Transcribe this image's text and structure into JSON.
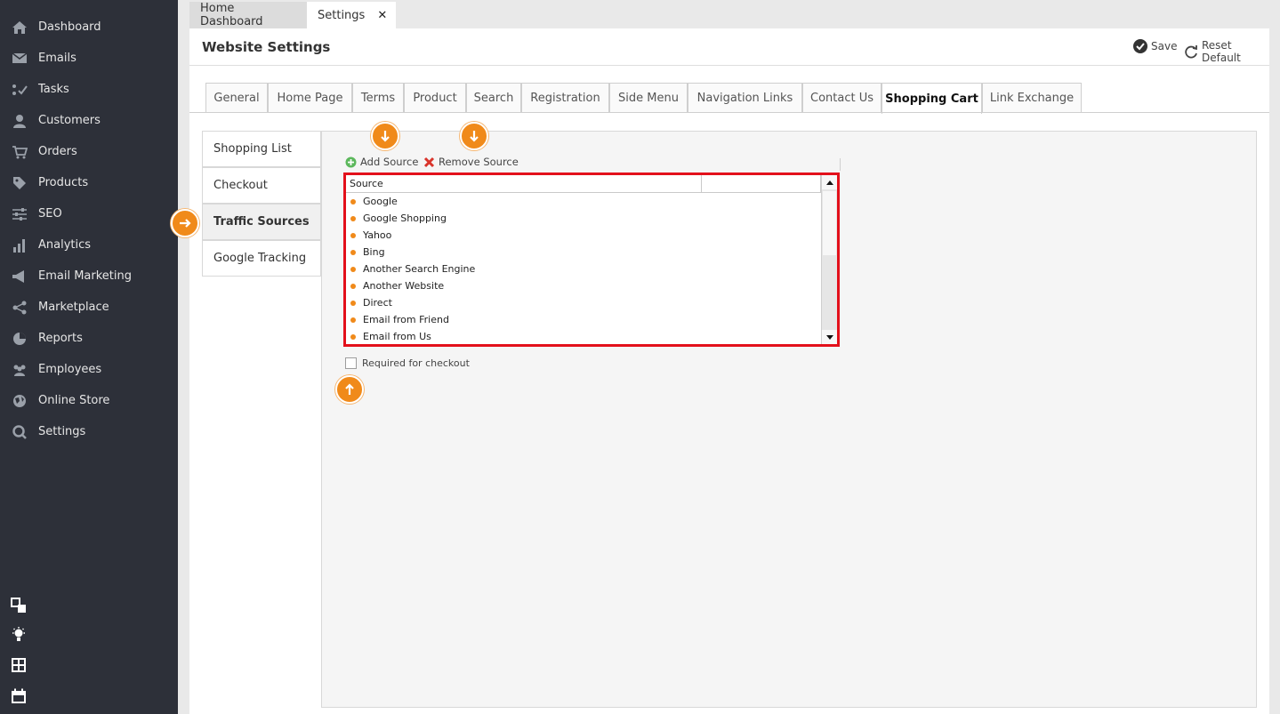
{
  "sidebar": {
    "items": [
      {
        "label": "Dashboard",
        "icon": "home-icon"
      },
      {
        "label": "Emails",
        "icon": "envelope-icon"
      },
      {
        "label": "Tasks",
        "icon": "tasks-icon"
      },
      {
        "label": "Customers",
        "icon": "user-icon"
      },
      {
        "label": "Orders",
        "icon": "cart-icon"
      },
      {
        "label": "Products",
        "icon": "tag-icon"
      },
      {
        "label": "SEO",
        "icon": "sliders-icon"
      },
      {
        "label": "Analytics",
        "icon": "bar-chart-icon"
      },
      {
        "label": "Email Marketing",
        "icon": "megaphone-icon"
      },
      {
        "label": "Marketplace",
        "icon": "share-icon"
      },
      {
        "label": "Reports",
        "icon": "pie-chart-icon"
      },
      {
        "label": "Employees",
        "icon": "group-icon"
      },
      {
        "label": "Online Store",
        "icon": "globe-icon"
      },
      {
        "label": "Settings",
        "icon": "settings-icon"
      }
    ],
    "bottom_icons": [
      "windows-icon",
      "lightbulb-icon",
      "calculator-icon",
      "calendar-icon"
    ]
  },
  "top_tabs": {
    "home": "Home Dashboard",
    "settings": "Settings",
    "close": "✕"
  },
  "header": {
    "title": "Website Settings",
    "save": "Save",
    "reset": "Reset Default"
  },
  "settings_tabs": [
    "General",
    "Home Page",
    "Terms",
    "Product",
    "Search",
    "Registration",
    "Side Menu",
    "Navigation Links",
    "Contact Us",
    "Shopping Cart",
    "Link Exchange"
  ],
  "active_settings_tab": "Shopping Cart",
  "side_menu": [
    "Shopping List",
    "Checkout",
    "Traffic Sources",
    "Google Tracking"
  ],
  "active_side_menu": "Traffic Sources",
  "toolbar": {
    "add": "Add Source",
    "remove": "Remove Source"
  },
  "grid": {
    "column": "Source",
    "rows": [
      "Google",
      "Google Shopping",
      "Yahoo",
      "Bing",
      "Another Search Engine",
      "Another Website",
      "Direct",
      "Email from Friend",
      "Email from Us"
    ]
  },
  "required_checkbox": {
    "label": "Required for checkout",
    "checked": false
  },
  "colors": {
    "sidebar_bg": "#2d3039",
    "accent_orange": "#f08a1a",
    "highlight_red": "#e3101b"
  }
}
